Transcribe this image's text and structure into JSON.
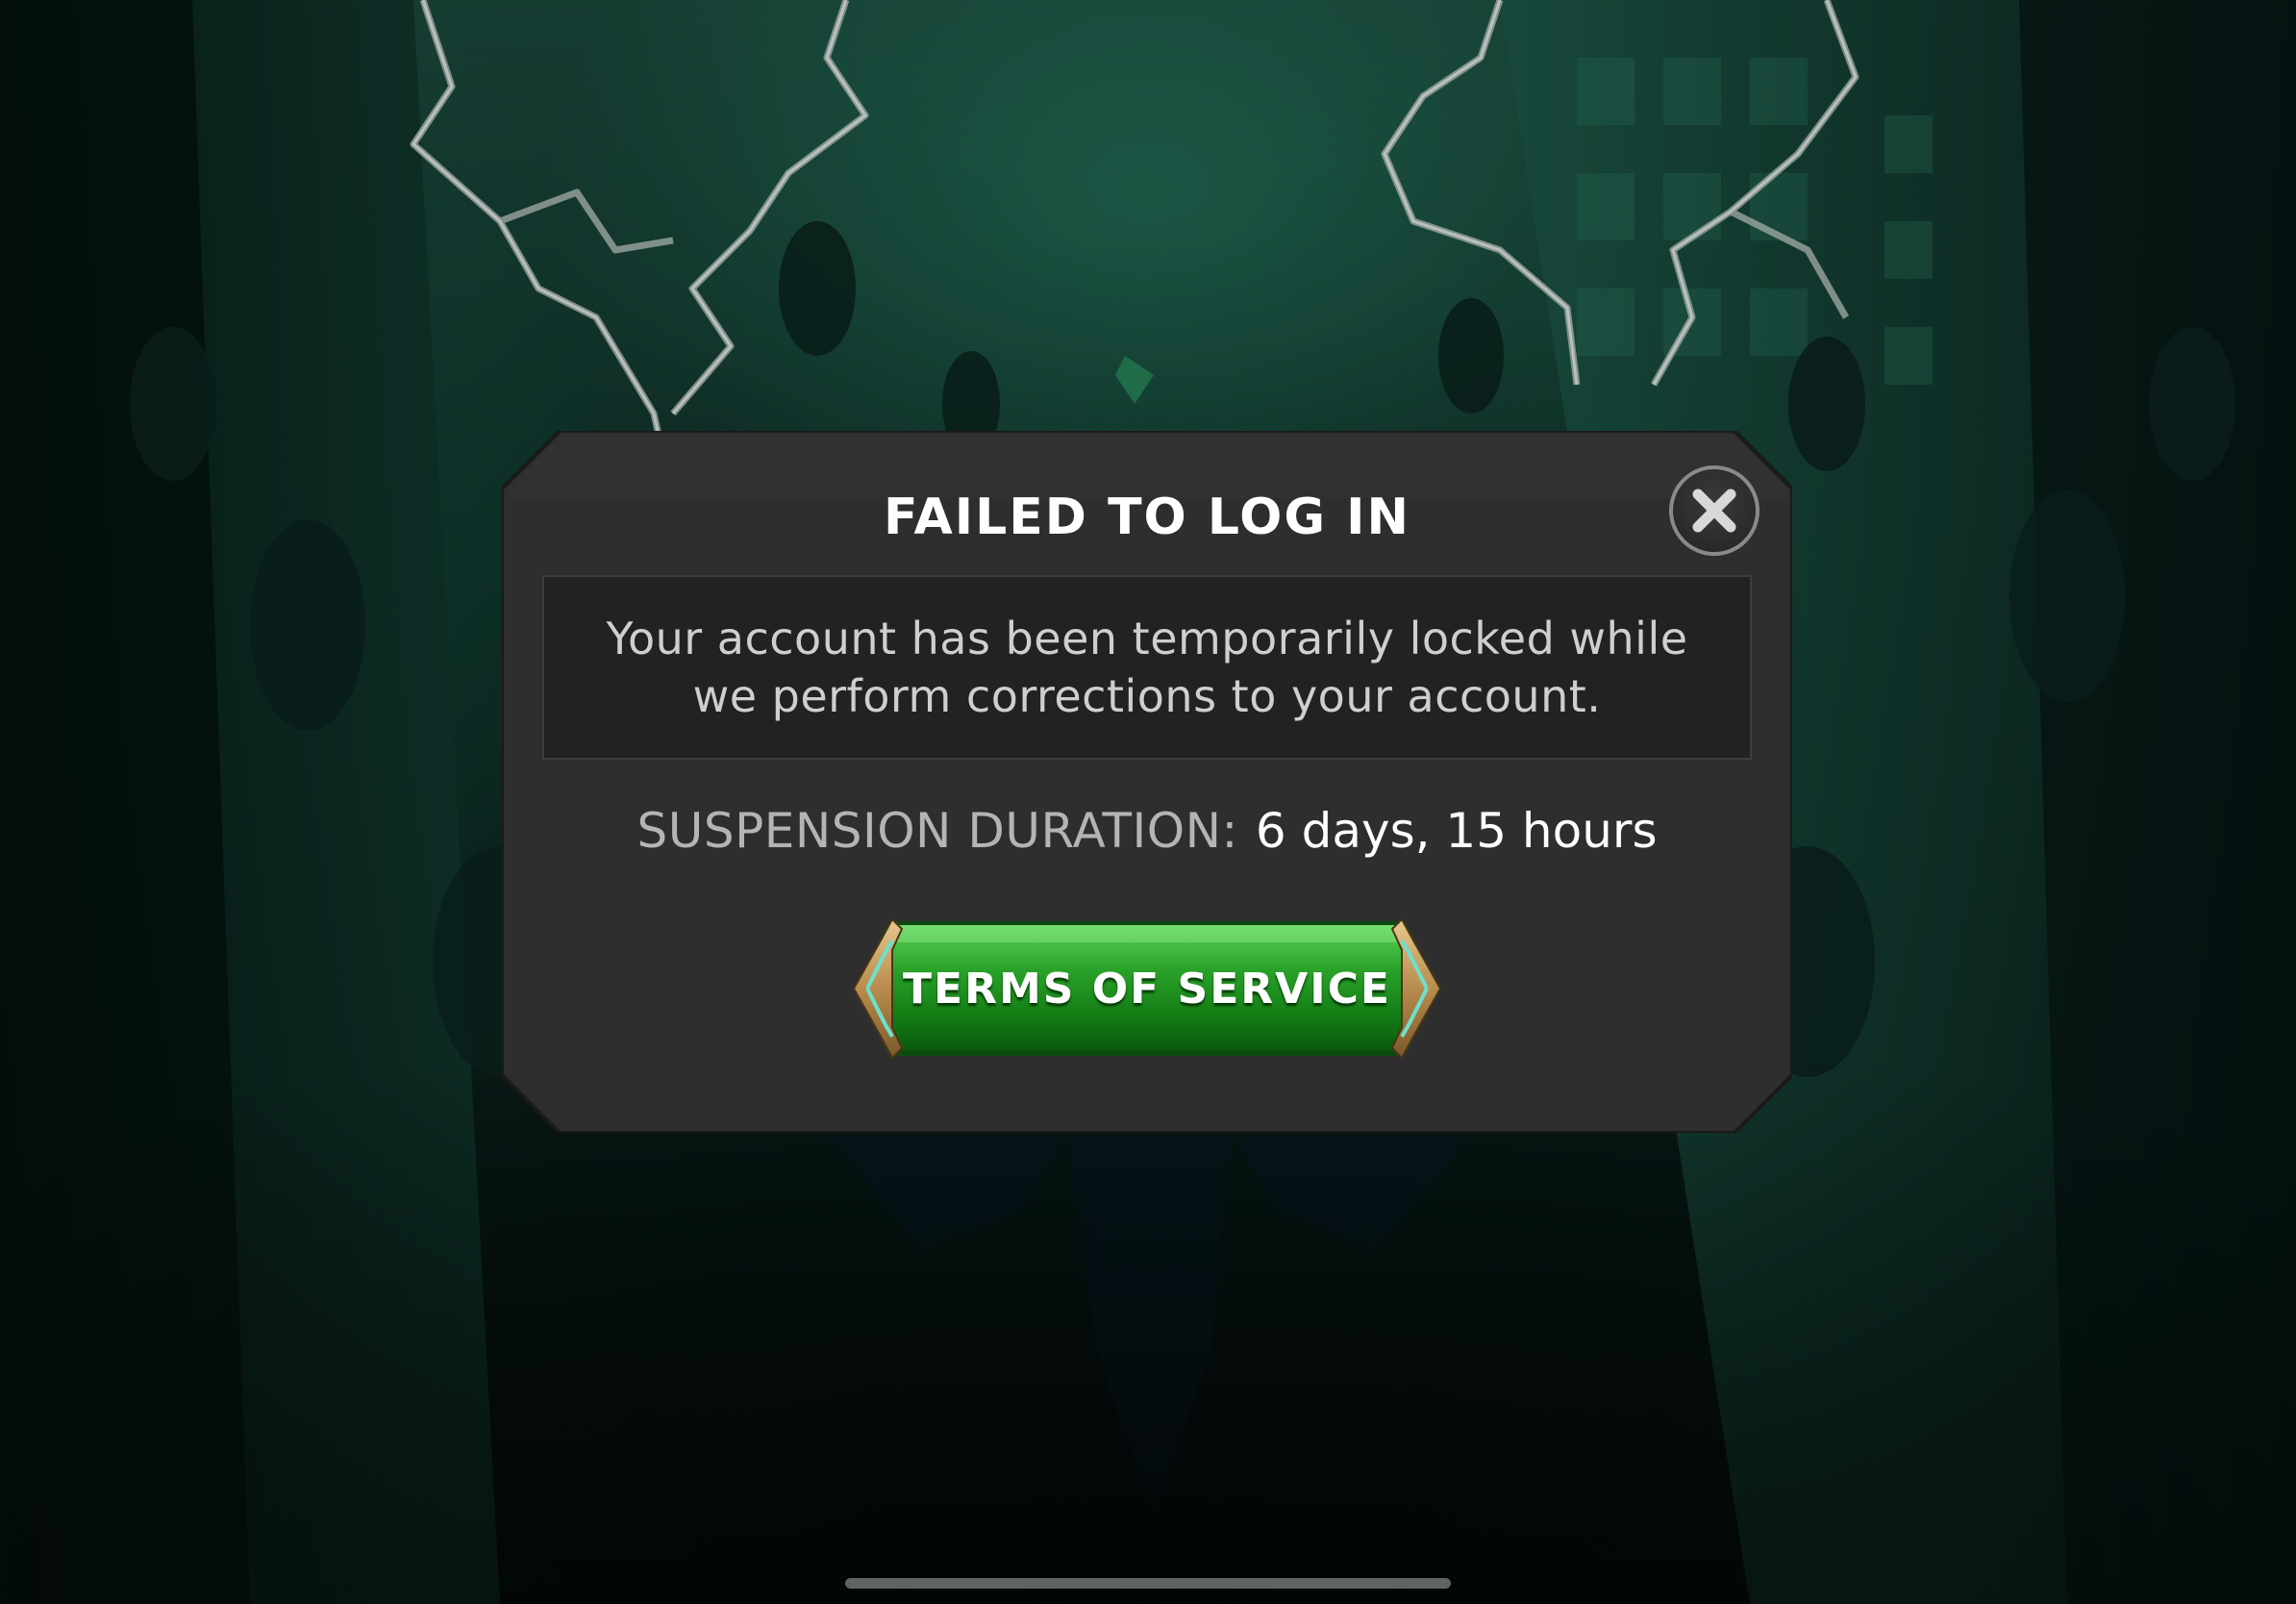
{
  "dialog": {
    "title": "FAILED TO LOG IN",
    "message": "Your account has been temporarily locked while we perform corrections to your account.",
    "duration_label": "SUSPENSION DURATION:",
    "duration_value": "6 days, 15 hours",
    "primary_button_label": "TERMS OF SERVICE",
    "close_icon": "close-icon"
  },
  "colors": {
    "dialog_background": "#2e2e2e",
    "message_background": "#222222",
    "button_green": "#1f9a1f",
    "button_trim": "#c7a46a",
    "button_trim_accent": "#59d6c4",
    "background_tint": "#1d4a3e"
  },
  "background": {
    "scene": "game-background-lightning-city"
  }
}
